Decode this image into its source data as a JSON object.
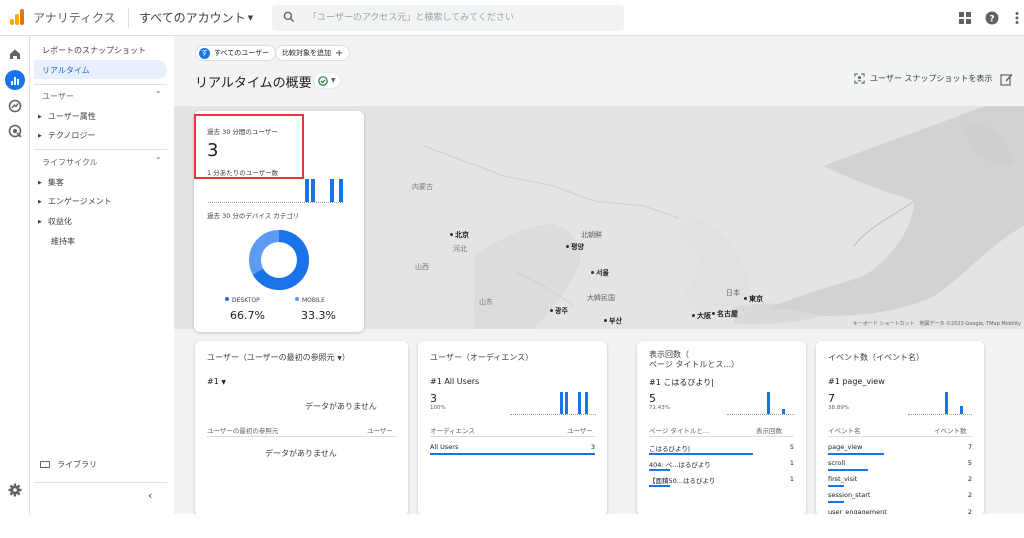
{
  "header": {
    "app_title": "アナリティクス",
    "account": "すべてのアカウント",
    "search_placeholder": "「ユーザーのアクセス元」と検索してみてください",
    "logo_colors": [
      "#f9ab00",
      "#e37400"
    ]
  },
  "sidebar": {
    "snapshot": "レポートのスナップショット",
    "realtime": "リアルタイム",
    "section_user": "ユーザー",
    "user_attributes": "ユーザー属性",
    "technology": "テクノロジー",
    "section_lifecycle": "ライフサイクル",
    "acquisition": "集客",
    "engagement": "エンゲージメント",
    "monetization": "収益化",
    "retention": "維持率",
    "library": "ライブラリ"
  },
  "toolbar": {
    "all_users": "すべてのユーザー",
    "compare": "比較対象を追加",
    "title": "リアルタイムの概要",
    "snapshot": "ユーザー スナップショットを表示"
  },
  "map": {
    "labels": {
      "inner_mongolia": "内蒙古",
      "beijing": "北京",
      "north_korea": "北朝鮮",
      "pyongyang": "평양",
      "seoul": "서울",
      "south_korea": "大韓民国",
      "gwangju": "광주",
      "busan": "부산",
      "japan": "日本",
      "tokyo": "東京",
      "osaka": "大阪",
      "nagoya": "名古屋",
      "china_prov": "山西",
      "china_prov2": "河北",
      "china_prov3": "山东",
      "china_prov4": "甘肃",
      "china_prov5": "宁"
    },
    "footer": "キーボード ショートカット　地図データ ©2023 Google, TMap Mobility"
  },
  "user_card": {
    "label_30": "過去 30 分間のユーザー",
    "value": "3",
    "label_per_min": "1 分あたりのユーザー数",
    "label_device": "過去 30 分のデバイス カテゴリ",
    "desktop_label": "DESKTOP",
    "desktop_pct": "66.7%",
    "mobile_label": "MOBILE",
    "mobile_pct": "33.3%",
    "desktop": 66.7,
    "mobile": 33.3,
    "colors": {
      "desktop": "#1a73e8",
      "mobile": "#5b9cf2"
    }
  },
  "cards": {
    "source": {
      "title": "ユーザー（ユーザーの最初の参照元",
      "rank": "#1",
      "nodata1": "データがありません",
      "col1": "ユーザーの最初の参照元",
      "col2": "ユーザー",
      "nodata2": "データがありません"
    },
    "audience": {
      "title": "ユーザー（オーディエンス）",
      "rank": "#1  All Users",
      "value": "3",
      "pct": "100%",
      "col1": "オーディエンス",
      "col2": "ユーザー",
      "rows": [
        {
          "name": "All Users",
          "val": "3"
        }
      ]
    },
    "pages": {
      "title1": "表示回数（",
      "title2": "ページ タイトルとス...）",
      "rank": "#1  こはるびより|",
      "value": "5",
      "pct": "71.43%",
      "col1": "ページ タイトルと...",
      "col2": "表示回数",
      "rows": [
        {
          "name": "こはるびより|",
          "val": "5"
        },
        {
          "name": "404: ペ...はるびより",
          "val": "1"
        },
        {
          "name": "【面積50...はるびより",
          "val": "1"
        }
      ]
    },
    "events": {
      "title": "イベント数（イベント名）",
      "rank": "#1  page_view",
      "value": "7",
      "pct": "38.89%",
      "col1": "イベント名",
      "col2": "イベント数",
      "rows": [
        {
          "name": "page_view",
          "val": "7"
        },
        {
          "name": "scroll",
          "val": "5"
        },
        {
          "name": "first_visit",
          "val": "2"
        },
        {
          "name": "session_start",
          "val": "2"
        },
        {
          "name": "user_engagement",
          "val": "2"
        }
      ]
    }
  }
}
